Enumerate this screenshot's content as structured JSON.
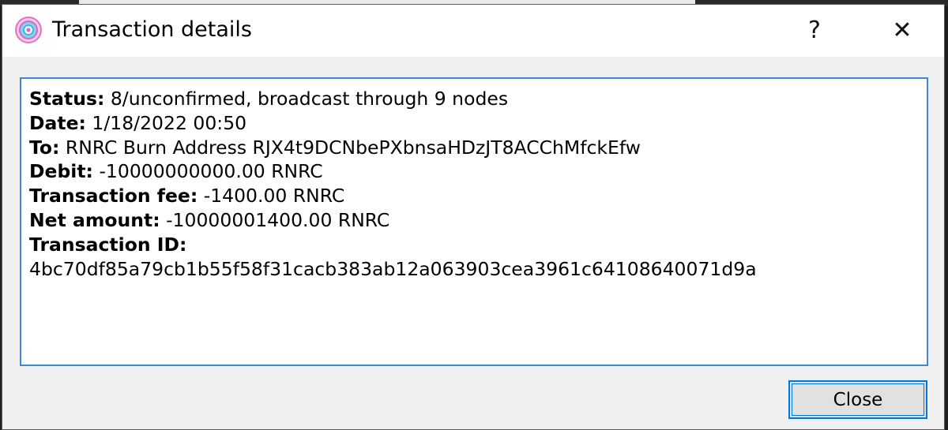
{
  "window": {
    "title": "Transaction details",
    "help_glyph": "?",
    "close_glyph": "✕",
    "app_icon": "wallet-logo-icon"
  },
  "details": {
    "status": {
      "label": "Status:",
      "value": " 8/unconfirmed, broadcast through 9 nodes"
    },
    "date": {
      "label": "Date:",
      "value": " 1/18/2022 00:50"
    },
    "to": {
      "label": "To:",
      "value": " RNRC Burn Address RJX4t9DCNbePXbnsaHDzJT8ACChMfckEfw"
    },
    "debit": {
      "label": "Debit:",
      "value": " -10000000000.00 RNRC"
    },
    "fee": {
      "label": "Transaction fee:",
      "value": " -1400.00 RNRC"
    },
    "net": {
      "label": "Net amount:",
      "value": " -10000001400.00 RNRC"
    },
    "txid": {
      "label": "Transaction ID:",
      "value": "4bc70df85a79cb1b55f58f31cacb383ab12a063903cea3961c64108640071d9a"
    }
  },
  "buttons": {
    "close_label": "Close"
  },
  "colors": {
    "focus_border": "#3c8ad6",
    "button_border": "#0078d7",
    "dialog_bg": "#f0f0f0"
  }
}
